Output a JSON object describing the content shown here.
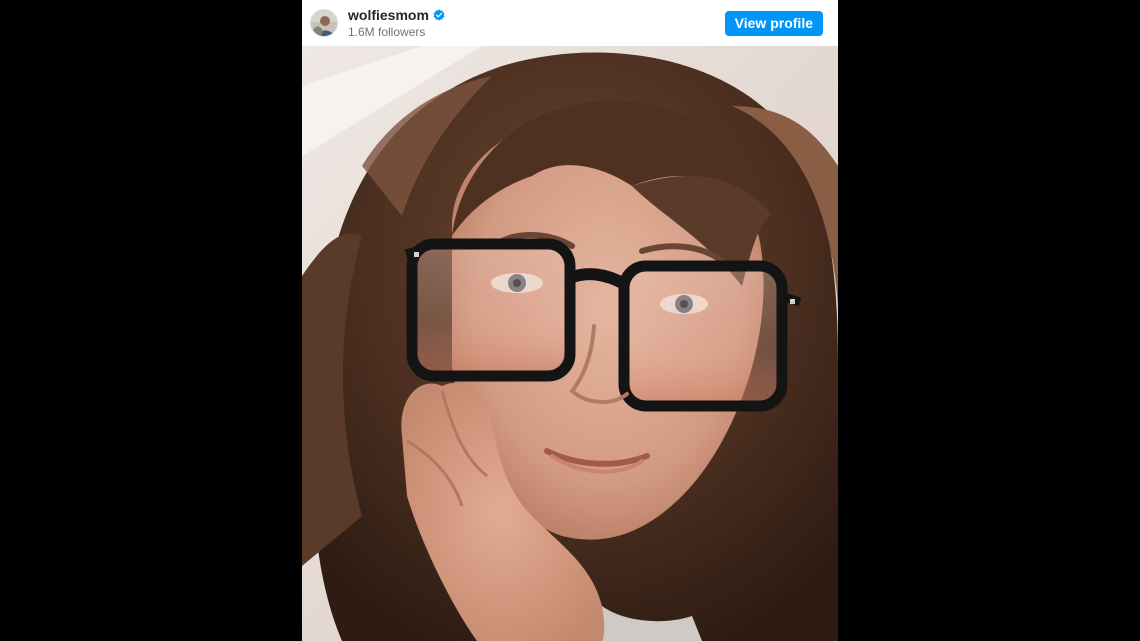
{
  "post": {
    "author": {
      "username": "wolfiesmom",
      "verified": true,
      "followers": "1.6M followers",
      "avatar_icon": "profile-avatar"
    },
    "view_profile_label": "View profile",
    "image": {
      "subject": "selfie-photo",
      "alt": ""
    }
  },
  "colors": {
    "background": "#000000",
    "embed_background": "#ffffff",
    "button": "#0095f6",
    "verified_badge": "#0095f6",
    "username": "#262626",
    "followers": "#737373"
  },
  "icons": {
    "verified": "verified-badge-icon"
  }
}
